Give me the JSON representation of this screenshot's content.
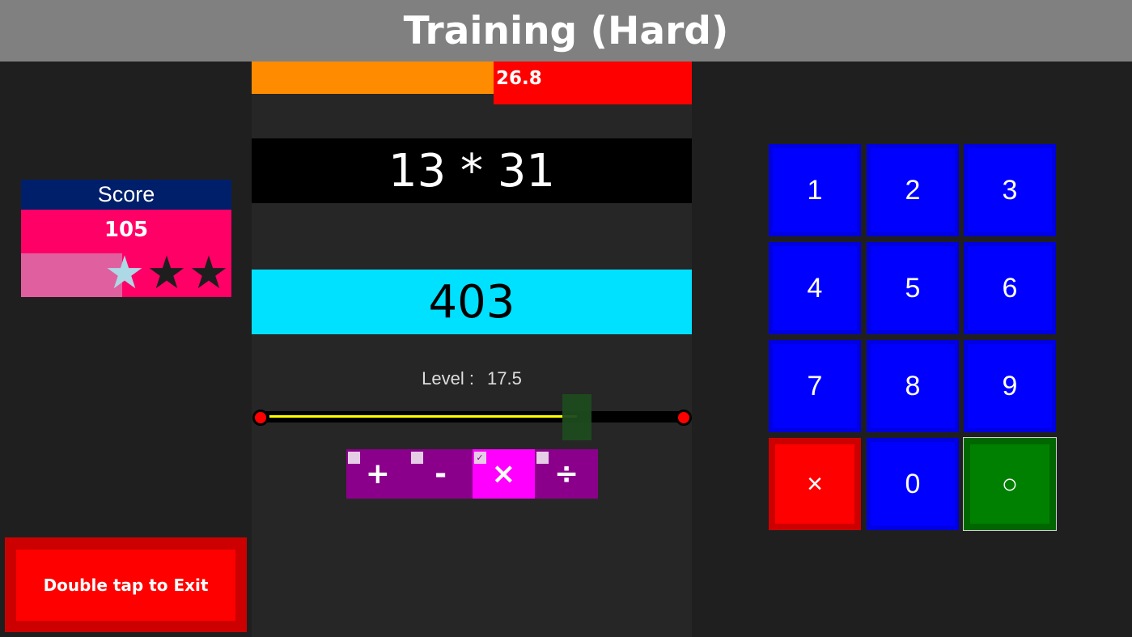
{
  "header": {
    "title": "Training (Hard)"
  },
  "timer": {
    "value_label": "26.8",
    "remaining_fraction": 0.45
  },
  "question": {
    "text": "13 * 31"
  },
  "answer": {
    "text": "403"
  },
  "level": {
    "label": "Level :",
    "value": "17.5",
    "slider_fraction": 0.75
  },
  "operations": [
    {
      "symbol": "+",
      "checked": false
    },
    {
      "symbol": "-",
      "checked": false
    },
    {
      "symbol": "×",
      "checked": true,
      "check_mark": "✓"
    },
    {
      "symbol": "÷",
      "checked": false
    }
  ],
  "score": {
    "label": "Score",
    "value": "105",
    "progress_fraction": 0.48,
    "stars": 3
  },
  "exit": {
    "label": "Double tap to Exit"
  },
  "keypad": {
    "keys": [
      "1",
      "2",
      "3",
      "4",
      "5",
      "6",
      "7",
      "8",
      "9",
      "×",
      "0",
      "○"
    ]
  },
  "colors": {
    "background": "#1f1f1f",
    "header": "#808080",
    "timer_elapsed": "#ff8c00",
    "timer_remaining": "#ff0000",
    "answer_bg": "#00e0ff",
    "key_blue": "#0000ff",
    "key_red": "#ff0000",
    "key_green": "#008000",
    "score_bg": "#ff0066",
    "score_header": "#001f6b",
    "op_bg": "#8b008b",
    "op_active": "#ff00ff"
  }
}
